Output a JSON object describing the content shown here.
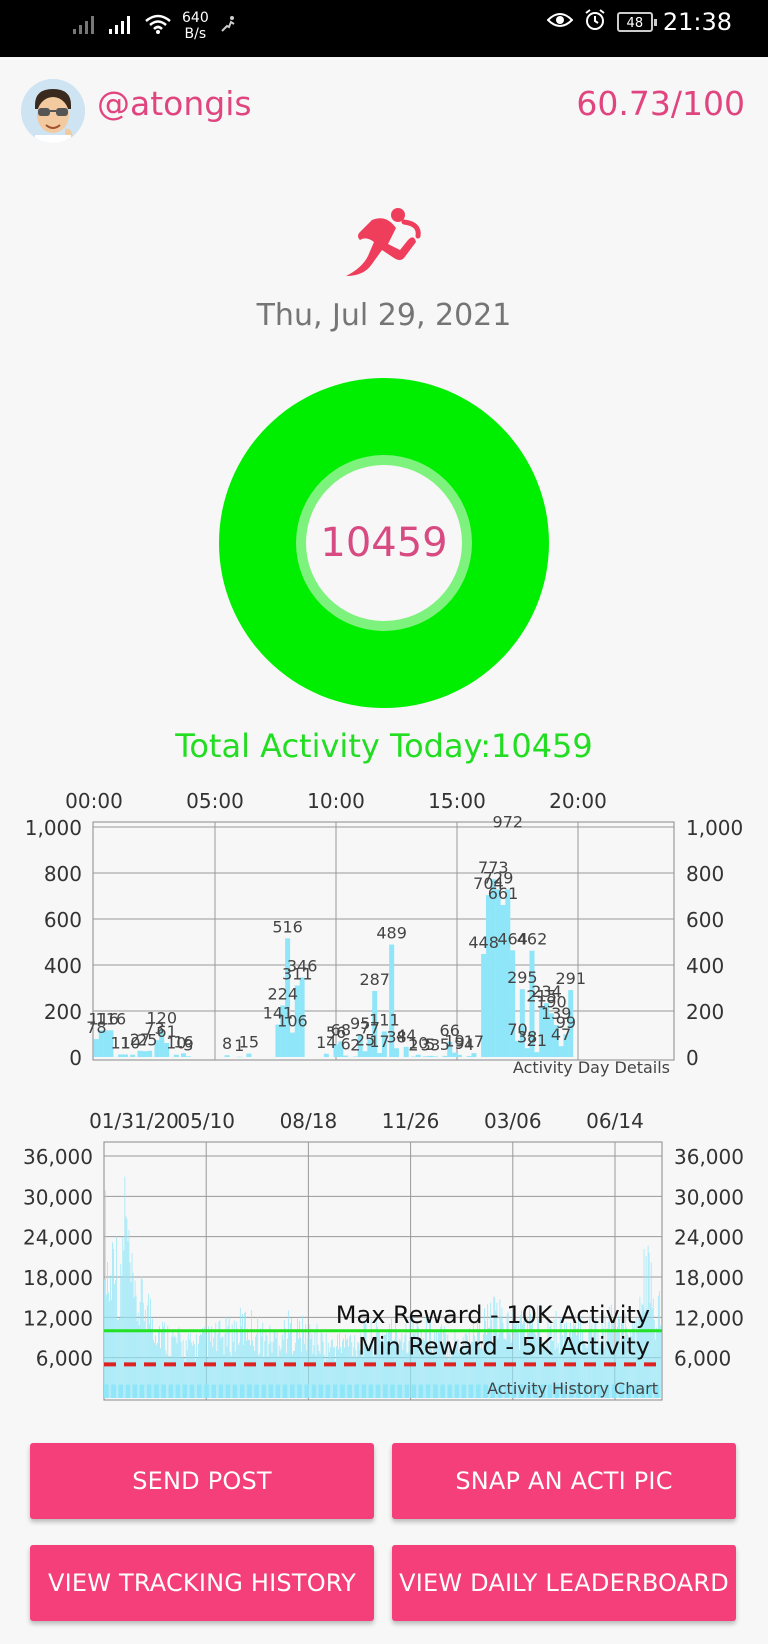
{
  "status_bar": {
    "speed_value": "640",
    "speed_unit": "B/s",
    "battery": "48",
    "time": "21:38"
  },
  "profile": {
    "username": "@atongis",
    "score": "60.73/100"
  },
  "date": "Thu, Jul 29, 2021",
  "ring": {
    "value": "10459",
    "color": "#00ee00"
  },
  "total_activity": "Total Activity Today:10459",
  "chart_data": [
    {
      "type": "bar",
      "caption": "Activity Day Details",
      "x_tick_labels": [
        "00:00",
        "05:00",
        "10:00",
        "15:00",
        "20:00"
      ],
      "y_tick_labels": [
        "0",
        "200",
        "400",
        "600",
        "800",
        "1,000"
      ],
      "ylim": [
        0,
        1000
      ],
      "xlim_hours": [
        0,
        24
      ],
      "grid": true,
      "bar_color": "#8fe6f8",
      "bars": [
        [
          0.1,
          78
        ],
        [
          0.3,
          116
        ],
        [
          0.5,
          116
        ],
        [
          0.7,
          116
        ],
        [
          1.1,
          11
        ],
        [
          1.3,
          11
        ],
        [
          1.6,
          10
        ],
        [
          1.9,
          27
        ],
        [
          2.1,
          25
        ],
        [
          2.3,
          27
        ],
        [
          2.6,
          73
        ],
        [
          2.8,
          120
        ],
        [
          3.0,
          61
        ],
        [
          3.4,
          10
        ],
        [
          3.7,
          16
        ],
        [
          3.9,
          3
        ],
        [
          5.5,
          8
        ],
        [
          6.0,
          1
        ],
        [
          6.4,
          15
        ],
        [
          7.6,
          141
        ],
        [
          7.8,
          224
        ],
        [
          8.0,
          516
        ],
        [
          8.2,
          106
        ],
        [
          8.4,
          311
        ],
        [
          8.6,
          346
        ],
        [
          9.6,
          14
        ],
        [
          10.0,
          56
        ],
        [
          10.2,
          68
        ],
        [
          10.4,
          6
        ],
        [
          10.8,
          2
        ],
        [
          11.0,
          95
        ],
        [
          11.2,
          25
        ],
        [
          11.4,
          77
        ],
        [
          11.6,
          287
        ],
        [
          11.8,
          17
        ],
        [
          12.0,
          111
        ],
        [
          12.3,
          489
        ],
        [
          12.5,
          38
        ],
        [
          12.9,
          44
        ],
        [
          13.2,
          2
        ],
        [
          13.4,
          10
        ],
        [
          13.7,
          3
        ],
        [
          13.9,
          5
        ],
        [
          14.1,
          3
        ],
        [
          14.5,
          5
        ],
        [
          14.7,
          66
        ],
        [
          14.9,
          19
        ],
        [
          15.1,
          9
        ],
        [
          15.5,
          4
        ],
        [
          15.7,
          17
        ],
        [
          16.1,
          448
        ],
        [
          16.3,
          704
        ],
        [
          16.5,
          773
        ],
        [
          16.7,
          729
        ],
        [
          16.9,
          661
        ],
        [
          17.1,
          729
        ],
        [
          17.3,
          464
        ],
        [
          17.5,
          70
        ],
        [
          17.7,
          295
        ],
        [
          17.9,
          38
        ],
        [
          18.1,
          462
        ],
        [
          18.3,
          21
        ],
        [
          18.5,
          215
        ],
        [
          18.7,
          234
        ],
        [
          18.9,
          190
        ],
        [
          19.1,
          139
        ],
        [
          19.3,
          47
        ],
        [
          19.5,
          99
        ],
        [
          19.7,
          291
        ]
      ],
      "shown_labels": [
        [
          0.1,
          "78"
        ],
        [
          0.4,
          "116"
        ],
        [
          0.7,
          "116"
        ],
        [
          1.1,
          "11"
        ],
        [
          1.5,
          "10"
        ],
        [
          1.9,
          "27"
        ],
        [
          2.2,
          "25"
        ],
        [
          2.5,
          "73"
        ],
        [
          2.8,
          "120"
        ],
        [
          3.0,
          "61"
        ],
        [
          3.4,
          "10"
        ],
        [
          3.7,
          "16"
        ],
        [
          3.9,
          "3"
        ],
        [
          5.5,
          "8"
        ],
        [
          6.0,
          "1"
        ],
        [
          6.4,
          "15"
        ],
        [
          7.6,
          "141"
        ],
        [
          7.8,
          "224"
        ],
        [
          8.0,
          "516"
        ],
        [
          8.2,
          "106"
        ],
        [
          8.4,
          "311"
        ],
        [
          8.6,
          "346"
        ],
        [
          9.6,
          "14"
        ],
        [
          10.0,
          "56"
        ],
        [
          10.2,
          "68"
        ],
        [
          10.4,
          "6"
        ],
        [
          10.8,
          "2"
        ],
        [
          11.0,
          "95"
        ],
        [
          11.2,
          "25"
        ],
        [
          11.4,
          "77"
        ],
        [
          11.6,
          "287"
        ],
        [
          11.8,
          "17"
        ],
        [
          12.0,
          "111"
        ],
        [
          12.3,
          "489"
        ],
        [
          12.5,
          "38"
        ],
        [
          12.9,
          "44"
        ],
        [
          13.2,
          "2"
        ],
        [
          13.4,
          "10"
        ],
        [
          13.7,
          "3"
        ],
        [
          13.9,
          "5"
        ],
        [
          14.1,
          "3"
        ],
        [
          14.5,
          "5"
        ],
        [
          14.7,
          "66"
        ],
        [
          14.9,
          "19"
        ],
        [
          15.1,
          "9"
        ],
        [
          15.5,
          "4"
        ],
        [
          15.7,
          "17"
        ],
        [
          16.1,
          "448"
        ],
        [
          16.3,
          "704"
        ],
        [
          16.5,
          "773"
        ],
        [
          16.7,
          "729"
        ],
        [
          16.9,
          "661"
        ],
        [
          17.1,
          "972"
        ],
        [
          17.3,
          "464"
        ],
        [
          17.5,
          "70"
        ],
        [
          17.7,
          "295"
        ],
        [
          17.9,
          "38"
        ],
        [
          18.1,
          "462"
        ],
        [
          18.3,
          "21"
        ],
        [
          18.5,
          "215"
        ],
        [
          18.7,
          "234"
        ],
        [
          18.9,
          "190"
        ],
        [
          19.1,
          "139"
        ],
        [
          19.3,
          "47"
        ],
        [
          19.5,
          "99"
        ],
        [
          19.7,
          "291"
        ]
      ]
    },
    {
      "type": "bar",
      "caption": "Activity History Chart",
      "x_tick_labels": [
        "01/31/20",
        "05/10",
        "08/18",
        "11/26",
        "03/06",
        "06/14"
      ],
      "y_tick_labels": [
        "6,000",
        "12,000",
        "18,000",
        "24,000",
        "30,000",
        "36,000"
      ],
      "ylim": [
        0,
        36000
      ],
      "grid": true,
      "bar_color": "#8fe6f8",
      "reference_lines": [
        {
          "label": "Max Reward - 10K Activity",
          "value": 10000,
          "color": "#22e022",
          "style": "solid"
        },
        {
          "label": "Min Reward - 5K Activity",
          "value": 5000,
          "color": "#dd2222",
          "style": "dashed"
        }
      ],
      "days": 546,
      "bar_profile": [
        [
          0,
          32000
        ],
        [
          5,
          18000
        ],
        [
          10,
          30000
        ],
        [
          15,
          15000
        ],
        [
          20,
          34000
        ],
        [
          25,
          22000
        ],
        [
          30,
          16000
        ],
        [
          40,
          17000
        ],
        [
          50,
          13000
        ],
        [
          60,
          11000
        ],
        [
          80,
          9000
        ],
        [
          100,
          10000
        ],
        [
          120,
          11000
        ],
        [
          140,
          13000
        ],
        [
          160,
          10000
        ],
        [
          180,
          12000
        ],
        [
          200,
          11000
        ],
        [
          220,
          9000
        ],
        [
          250,
          10500
        ],
        [
          280,
          11500
        ],
        [
          300,
          12000
        ],
        [
          320,
          11000
        ],
        [
          340,
          10000
        ],
        [
          360,
          11000
        ],
        [
          380,
          14000
        ],
        [
          400,
          12500
        ],
        [
          420,
          13000
        ],
        [
          440,
          12000
        ],
        [
          460,
          11500
        ],
        [
          480,
          12000
        ],
        [
          500,
          13000
        ],
        [
          520,
          10500
        ],
        [
          530,
          23000
        ],
        [
          540,
          14000
        ],
        [
          546,
          15000
        ]
      ]
    }
  ],
  "buttons": {
    "send_post": "SEND POST",
    "snap_pic": "SNAP AN ACTI PIC",
    "view_history": "VIEW TRACKING HISTORY",
    "view_leaderboard": "VIEW DAILY LEADERBOARD"
  },
  "colors": {
    "accent_pink": "#e0457f",
    "button_pink": "#f43f7b",
    "green": "#22dd22"
  }
}
